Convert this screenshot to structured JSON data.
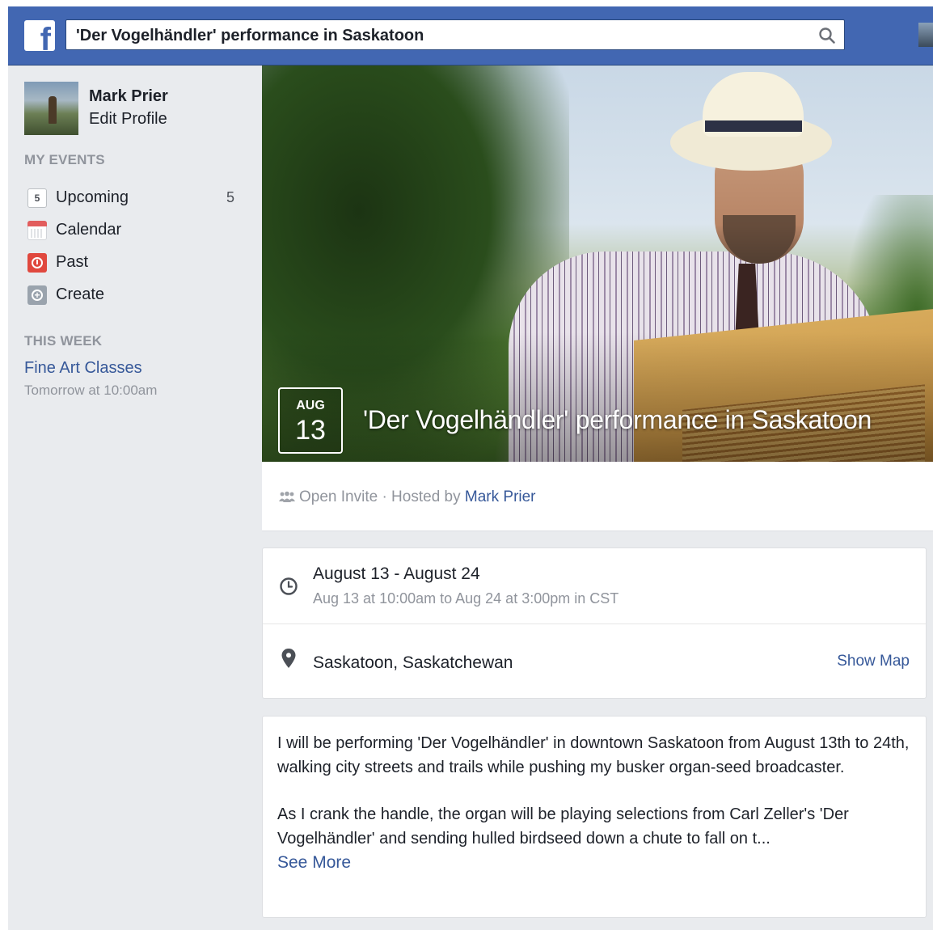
{
  "search": {
    "value": "'Der Vogelhändler' performance in Saskatoon"
  },
  "profile": {
    "name": "Mark Prier",
    "edit_label": "Edit Profile"
  },
  "sidebar": {
    "my_events_heading": "MY EVENTS",
    "items": [
      {
        "label": "Upcoming",
        "count": "5",
        "icon_text": "5",
        "icon": "upcoming-icon"
      },
      {
        "label": "Calendar",
        "icon": "calendar-icon"
      },
      {
        "label": "Past",
        "icon": "clock-past-icon"
      },
      {
        "label": "Create",
        "icon": "create-icon"
      }
    ],
    "this_week_heading": "THIS WEEK",
    "this_week_event": {
      "title": "Fine Art Classes",
      "time": "Tomorrow at 10:00am"
    }
  },
  "event": {
    "month": "AUG",
    "day": "13",
    "title": "'Der Vogelhändler' performance in Saskatoon",
    "privacy": "Open Invite",
    "hosted_by_prefix": "· Hosted by",
    "host": "Mark Prier",
    "date_range": "August 13 - August 24",
    "time_detail": "Aug 13 at 10:00am to Aug 24 at 3:00pm in CST",
    "location": "Saskatoon, Saskatchewan",
    "show_map": "Show Map",
    "description_p1": "I will be performing 'Der Vogelhändler' in downtown Saskatoon from August 13th to 24th, walking city streets and trails while pushing my busker organ-seed broadcaster.",
    "description_p2": "As I crank the handle, the organ will be playing selections from Carl Zeller's 'Der Vogelhändler' and sending hulled birdseed down a chute to fall on t...",
    "see_more": "See More"
  },
  "colors": {
    "brand": "#4267b2",
    "link": "#365899",
    "page_bg": "#e9ebee"
  }
}
